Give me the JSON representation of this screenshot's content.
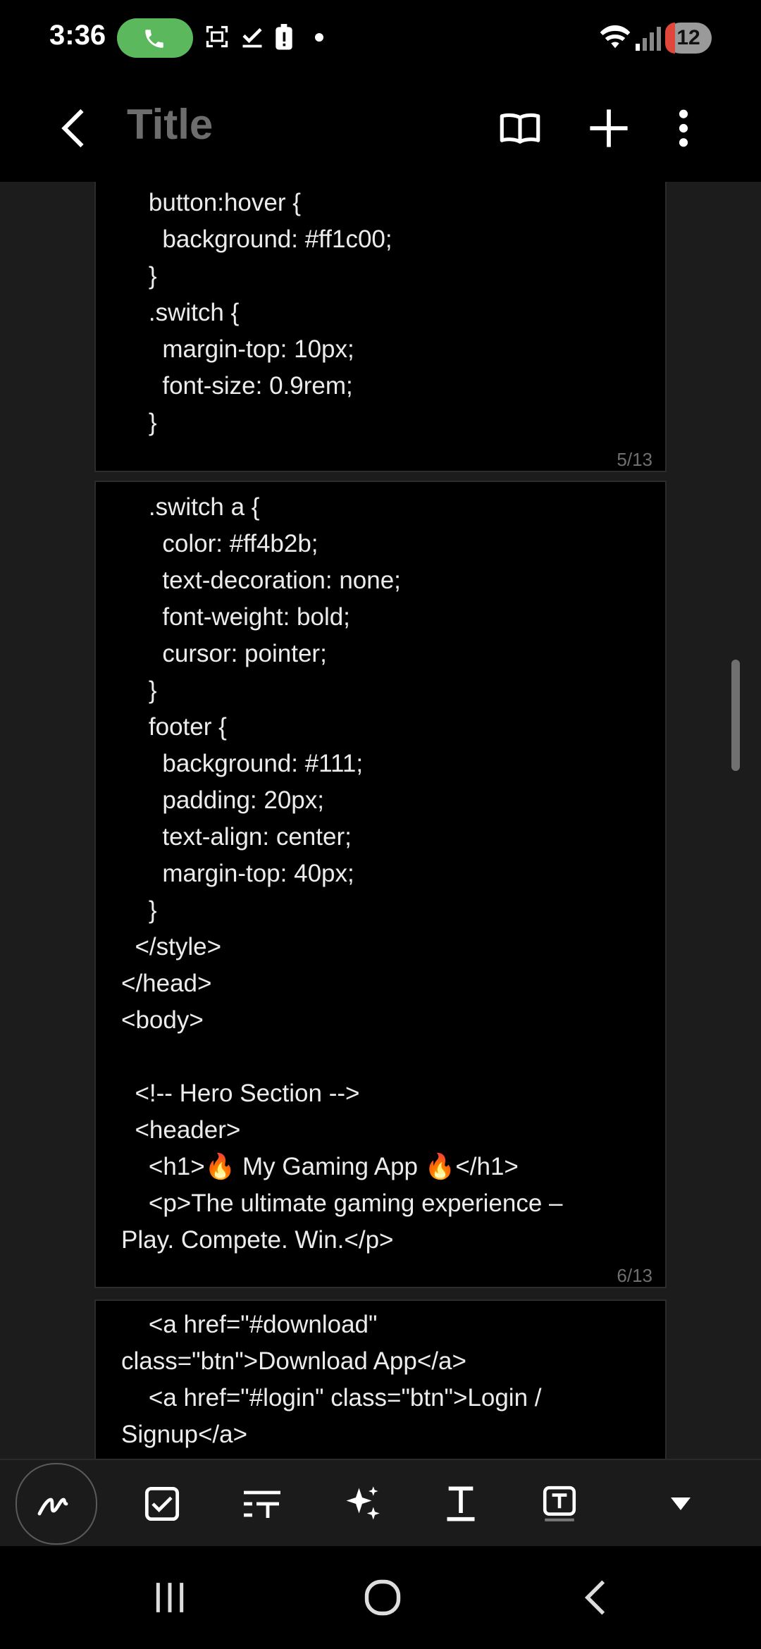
{
  "status_bar": {
    "time": "3:36",
    "notification_count": "12",
    "icons": [
      "call-icon",
      "screenshot-icon",
      "check-icon",
      "alert-icon",
      "dot-icon",
      "wifi-icon",
      "signal-icon"
    ]
  },
  "app_bar": {
    "title": "Title",
    "icons": [
      "back-icon",
      "book-icon",
      "add-icon",
      "more-icon"
    ]
  },
  "pages": [
    {
      "lines": [
        "    button:hover {",
        "      background: #ff1c00;",
        "    }",
        "    .switch {",
        "      margin-top: 10px;",
        "      font-size: 0.9rem;",
        "    }"
      ],
      "page_number": "5/13"
    },
    {
      "lines": [
        "    .switch a {",
        "      color: #ff4b2b;",
        "      text-decoration: none;",
        "      font-weight: bold;",
        "      cursor: pointer;",
        "    }",
        "    footer {",
        "      background: #111;",
        "      padding: 20px;",
        "      text-align: center;",
        "      margin-top: 40px;",
        "    }",
        "  </style>",
        "</head>",
        "<body>",
        "",
        "  <!-- Hero Section -->",
        "  <header>",
        "    <h1>🔥 My Gaming App 🔥</h1>",
        "    <p>The ultimate gaming experience –",
        "Play. Compete. Win.</p>"
      ],
      "page_number": "6/13"
    },
    {
      "lines": [
        "    <a href=\"#download\"",
        "class=\"btn\">Download App</a>",
        "    <a href=\"#login\" class=\"btn\">Login /",
        "Signup</a>"
      ]
    }
  ],
  "toolbar": {
    "tools": [
      "pen-icon",
      "checkbox-icon",
      "text-size-icon",
      "ai-sparkle-icon",
      "text-format-icon",
      "text-box-icon",
      "dropdown-arrow-icon"
    ]
  },
  "nav_bar": {
    "icons": [
      "recents-icon",
      "home-icon",
      "back-icon"
    ]
  },
  "colors": {
    "background": "#000000",
    "content_bg": "#1c1c1c",
    "call_pill": "#5cb85c",
    "title_text": "#6d6d6d",
    "code_text": "#ececec"
  }
}
